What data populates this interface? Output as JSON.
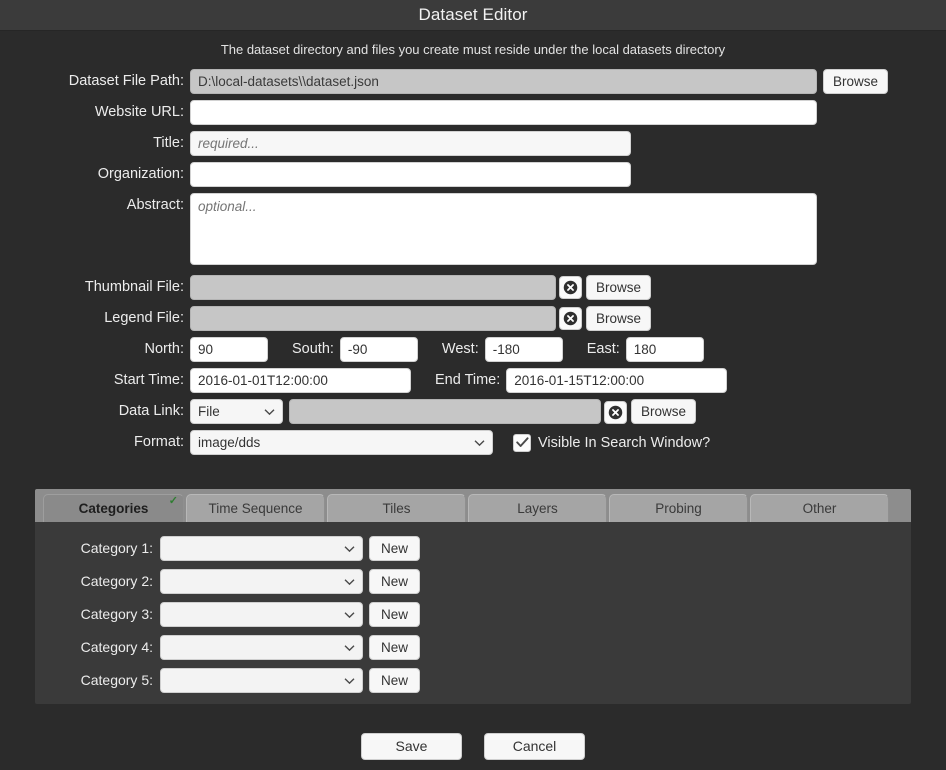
{
  "window": {
    "title": "Dataset Editor",
    "subtitle": "The dataset directory and files you create must reside under the local datasets directory"
  },
  "form": {
    "dataset_file_path": {
      "label": "Dataset File Path:",
      "value": "D:\\local-datasets\\\\dataset.json",
      "browse_label": "Browse"
    },
    "website_url": {
      "label": "Website URL:",
      "value": "",
      "placeholder": ""
    },
    "title": {
      "label": "Title:",
      "value": "",
      "placeholder": "required..."
    },
    "organization": {
      "label": "Organization:",
      "value": "",
      "placeholder": ""
    },
    "abstract": {
      "label": "Abstract:",
      "value": "",
      "placeholder": "optional..."
    },
    "thumbnail_file": {
      "label": "Thumbnail File:",
      "value": "",
      "clear_icon": "circle-x-icon",
      "browse_label": "Browse"
    },
    "legend_file": {
      "label": "Legend File:",
      "value": "",
      "clear_icon": "circle-x-icon",
      "browse_label": "Browse"
    },
    "bounds": {
      "north": {
        "label": "North:",
        "value": "90"
      },
      "south": {
        "label": "South:",
        "value": "-90"
      },
      "west": {
        "label": "West:",
        "value": "-180"
      },
      "east": {
        "label": "East:",
        "value": "180"
      }
    },
    "times": {
      "start": {
        "label": "Start Time:",
        "value": "2016-01-01T12:00:00"
      },
      "end": {
        "label": "End Time:",
        "value": "2016-01-15T12:00:00"
      }
    },
    "data_link": {
      "label": "Data Link:",
      "type_value": "File",
      "type_options": [
        "File"
      ],
      "path_value": "",
      "clear_icon": "circle-x-icon",
      "browse_label": "Browse"
    },
    "format": {
      "label": "Format:",
      "value": "image/dds",
      "options": [
        "image/dds"
      ]
    },
    "visible_in_search": {
      "label": "Visible In Search Window?",
      "checked": true,
      "check_icon": "checkmark-icon"
    }
  },
  "tabs": {
    "items": [
      {
        "label": "Categories",
        "active": true,
        "check": "✓"
      },
      {
        "label": "Time Sequence",
        "active": false
      },
      {
        "label": "Tiles",
        "active": false
      },
      {
        "label": "Layers",
        "active": false
      },
      {
        "label": "Probing",
        "active": false
      },
      {
        "label": "Other",
        "active": false
      }
    ],
    "active_check_color": "#2f7d32"
  },
  "categories": {
    "rows": [
      {
        "label": "Category 1:",
        "value": "",
        "new_label": "New"
      },
      {
        "label": "Category 2:",
        "value": "",
        "new_label": "New"
      },
      {
        "label": "Category 3:",
        "value": "",
        "new_label": "New"
      },
      {
        "label": "Category 4:",
        "value": "",
        "new_label": "New"
      },
      {
        "label": "Category 5:",
        "value": "",
        "new_label": "New"
      }
    ]
  },
  "footer": {
    "save_label": "Save",
    "cancel_label": "Cancel"
  },
  "colors": {
    "window_bg": "#2b2b2b",
    "titlebar_bg": "#3b3b3b",
    "panel_bg": "#3a3a3a",
    "tabstrip_bg": "#8d8d8d",
    "tab_bg": "#a5a5a5",
    "tab_active_bg": "#8a8a8a",
    "field_bg": "#ffffff",
    "readonly_field_bg": "#c6c6c6",
    "button_bg": "#f7f7f7",
    "text": "#ececec",
    "check_green": "#2f7d32"
  }
}
